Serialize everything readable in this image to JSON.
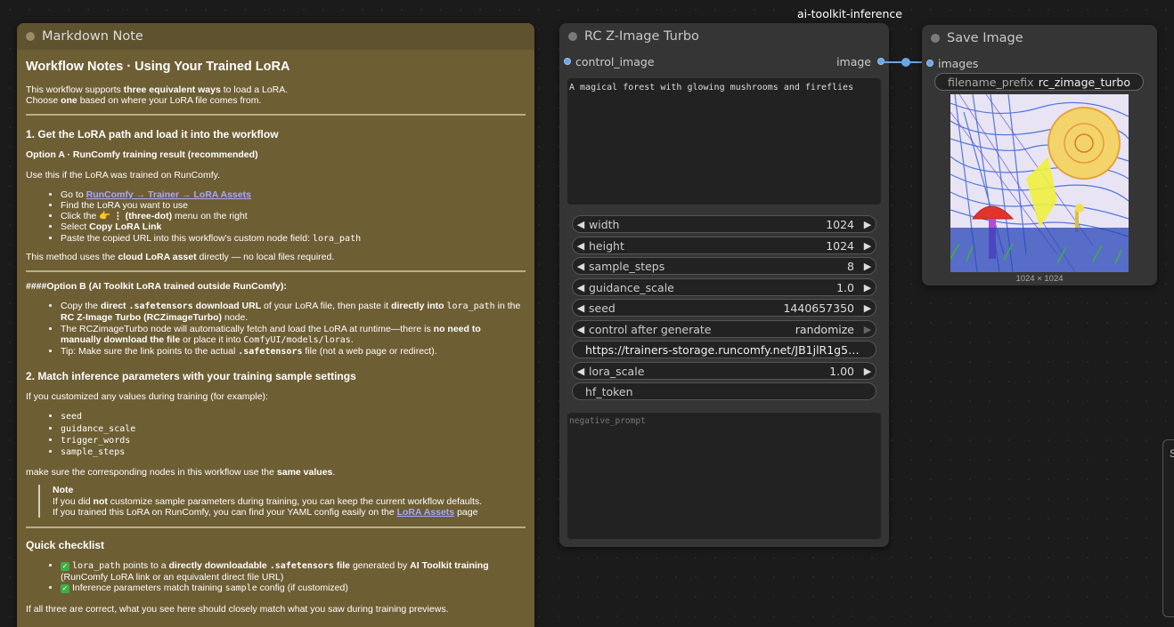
{
  "group_label": "ai-toolkit-inference",
  "markdown_node": {
    "title": "Markdown Note",
    "heading": "Workflow Notes · Using Your Trained LoRA",
    "intro_1a": "This workflow supports ",
    "intro_1b": "three equivalent ways",
    "intro_1c": " to load a LoRA.",
    "intro_2a": "Choose ",
    "intro_2b": "one",
    "intro_2c": " based on where your LoRA file comes from.",
    "section1_title": "1. Get the LoRA path and load it into the workflow",
    "optionA_title": "Option A · RunComfy training result (recommended)",
    "optionA_use": "Use this if the LoRA was trained on RunComfy.",
    "optionA_step1_prefix": "Go to ",
    "optionA_step1_link": "RunComfy → Trainer → LoRA Assets",
    "optionA_step2": "Find the LoRA you want to use",
    "optionA_step3_a": "Click the 👉",
    "optionA_step3_b": " ⋮ (three-dot)",
    "optionA_step3_c": " menu on the right",
    "optionA_step4_a": "Select ",
    "optionA_step4_b": "Copy LoRA Link",
    "optionA_step5_a": "Paste the copied URL into this workflow's custom node field: ",
    "optionA_step5_code": "lora_path",
    "optionA_method_a": "This method uses the ",
    "optionA_method_b": "cloud LoRA asset",
    "optionA_method_c": " directly — no local files required.",
    "optionB_title": "####Option B (AI Toolkit LoRA trained outside RunComfy):",
    "optionB_s1_a": "Copy the ",
    "optionB_s1_b": "direct ",
    "optionB_s1_code": ".safetensors",
    "optionB_s1_c": " download URL",
    "optionB_s1_d": " of your LoRA file, then paste it ",
    "optionB_s1_e": "directly into ",
    "optionB_s1_code2": "lora_path",
    "optionB_s1_f": " in the ",
    "optionB_s1_g": "RC Z-Image Turbo (RCZimageTurbo)",
    "optionB_s1_h": " node.",
    "optionB_s2_a": "The RCZimageTurbo node will automatically fetch and load the LoRA at runtime—there is ",
    "optionB_s2_b": "no need to manually download the file",
    "optionB_s2_c": " or place it into ",
    "optionB_s2_code": "ComfyUI/models/loras",
    "optionB_s2_d": ".",
    "optionB_s3_a": "Tip: Make sure the link points to the actual ",
    "optionB_s3_code": ".safetensors",
    "optionB_s3_b": " file (not a web page or redirect).",
    "section2_title": "2. Match inference parameters with your training sample settings",
    "section2_intro": "If you customized any values during training (for example):",
    "section2_params": [
      "seed",
      "guidance_scale",
      "trigger_words",
      "sample_steps"
    ],
    "section2_make_a": "make sure the corresponding nodes in this workflow use the ",
    "section2_make_b": "same values",
    "section2_make_c": ".",
    "note_title": "Note",
    "note_l1_a": "If you did ",
    "note_l1_b": "not",
    "note_l1_c": " customize sample parameters during training, you can keep the current workflow defaults.",
    "note_l2_a": "If you trained this LoRA on RunComfy, you can find your YAML config easily on the ",
    "note_l2_link": "LoRA Assets",
    "note_l2_b": " page",
    "checklist_title": "Quick checklist",
    "check1_code": "lora_path",
    "check1_a": " points to a ",
    "check1_b": "directly downloadable ",
    "check1_code2": ".safetensors",
    "check1_c": " file",
    "check1_d": " generated by ",
    "check1_e": "AI Toolkit training",
    "check1_f": "(RunComfy LoRA link or an equivalent direct file URL)",
    "check2_a": "Inference parameters match training ",
    "check2_code": "sample",
    "check2_b": " config (if customized)",
    "closing": "If all three are correct, what you see here should closely match what you saw during training previews."
  },
  "rc_node": {
    "title": "RC Z-Image Turbo",
    "input_label": "control_image",
    "output_label": "image",
    "prompt": "A magical forest with glowing mushrooms and fireflies",
    "negative_placeholder": "negative_prompt",
    "widgets": {
      "width_label": "width",
      "width_value": "1024",
      "height_label": "height",
      "height_value": "1024",
      "steps_label": "sample_steps",
      "steps_value": "8",
      "guidance_label": "guidance_scale",
      "guidance_value": "1.0",
      "seed_label": "seed",
      "seed_value": "1440657350",
      "control_label": "control after generate",
      "control_value": "randomize",
      "lora_path_value": "https://trainers-storage.runcomfy.net/JB1jlR1g5CMPvB ...",
      "lora_scale_label": "lora_scale",
      "lora_scale_value": "1.00",
      "hf_token_label": "hf_token"
    }
  },
  "save_node": {
    "title": "Save Image",
    "input_label": "images",
    "prefix_label": "filename_prefix",
    "prefix_value": "rc_zimage_turbo",
    "image_size": "1024 × 1024"
  },
  "edge_fragment": "S",
  "colors": {
    "link": "#6aa6e6",
    "note_bg": "#6e5e34",
    "node_bg": "#353535"
  }
}
